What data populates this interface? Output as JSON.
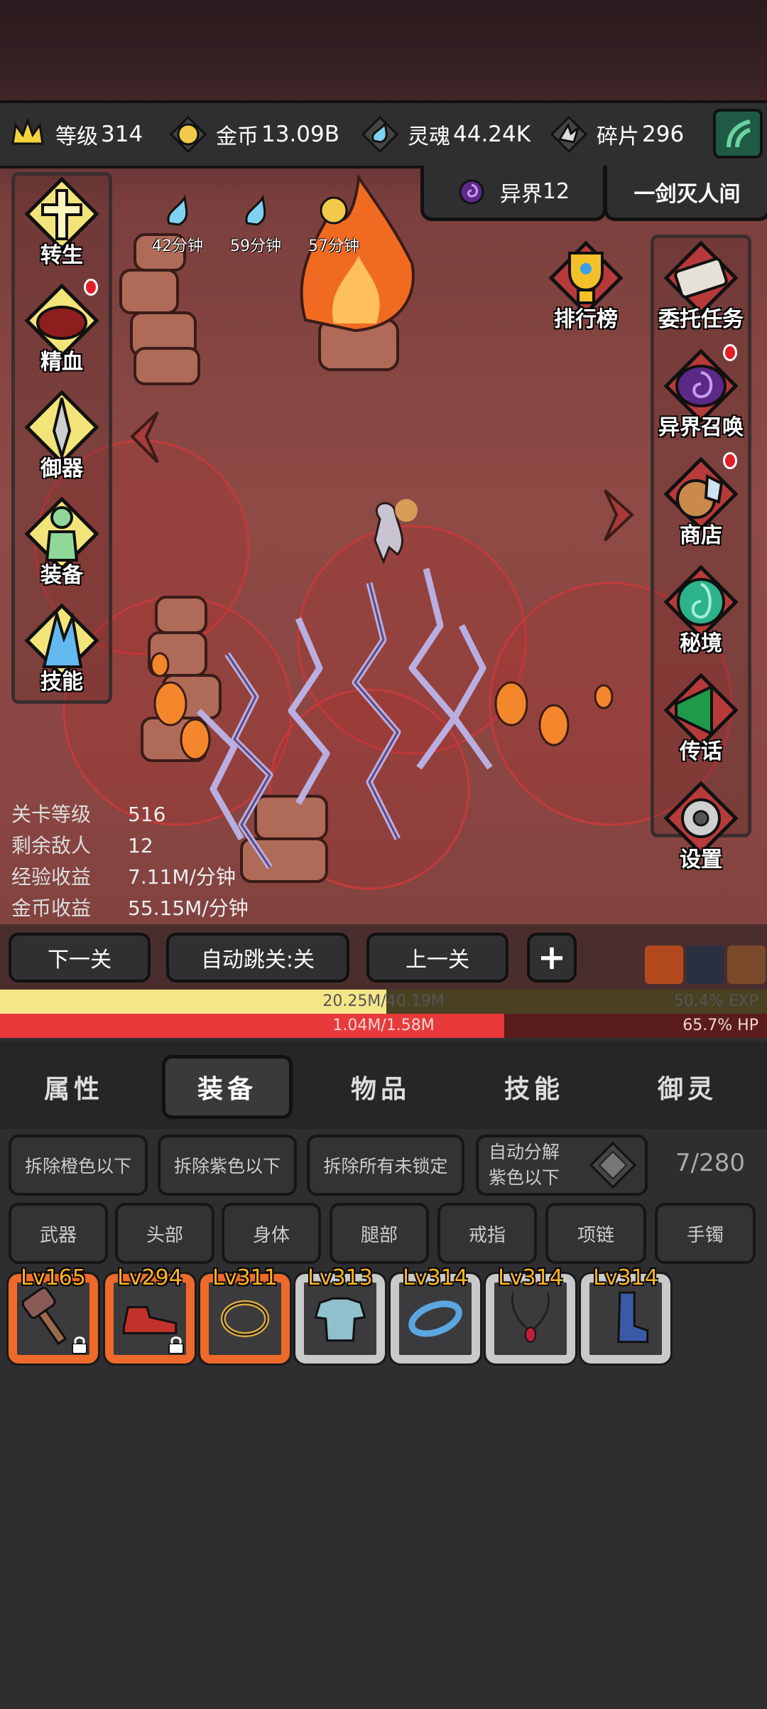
{
  "resources": [
    {
      "label": "等级",
      "value": "314",
      "icon": "crown-icon"
    },
    {
      "label": "金币",
      "value": "13.09B",
      "icon": "gold-coin-icon"
    },
    {
      "label": "灵魂",
      "value": "44.24K",
      "icon": "soul-icon"
    },
    {
      "label": "碎片",
      "value": "296",
      "icon": "shard-icon"
    }
  ],
  "top_tabs": {
    "otherworld": {
      "label": "异界",
      "value": "12"
    },
    "title": "一剑灭人间"
  },
  "timers": [
    "42分钟",
    "59分钟",
    "57分钟"
  ],
  "left_menu": [
    {
      "label": "转生",
      "icon": "rebirth-cross-icon",
      "badge": false
    },
    {
      "label": "精血",
      "icon": "blood-meat-icon",
      "badge": true
    },
    {
      "label": "御器",
      "icon": "sword-icon",
      "badge": false
    },
    {
      "label": "装备",
      "icon": "armor-figure-icon",
      "badge": false
    },
    {
      "label": "技能",
      "icon": "ice-crystal-icon",
      "badge": false
    }
  ],
  "right_menu": [
    {
      "label": "排行榜",
      "icon": "trophy-icon",
      "badge": false
    },
    {
      "label": "委托任务",
      "icon": "scroll-icon",
      "badge": false
    },
    {
      "label": "异界召唤",
      "icon": "portal-icon",
      "badge": true
    },
    {
      "label": "商店",
      "icon": "shop-pot-icon",
      "badge": true
    },
    {
      "label": "秘境",
      "icon": "secret-realm-icon",
      "badge": false
    },
    {
      "label": "传话",
      "icon": "megaphone-icon",
      "badge": false
    },
    {
      "label": "设置",
      "icon": "gear-icon",
      "badge": false
    }
  ],
  "stats": [
    {
      "key": "关卡等级",
      "value": "516"
    },
    {
      "key": "剩余敌人",
      "value": "12"
    },
    {
      "key": "经验收益",
      "value": "7.11M/分钟"
    },
    {
      "key": "金币收益",
      "value": "55.15M/分钟"
    }
  ],
  "actions": {
    "next": "下一关",
    "auto_skip": "自动跳关:关",
    "prev": "上一关",
    "plus": "+"
  },
  "exp_bar": {
    "text": "20.25M/40.19M",
    "percent": "50.4% EXP",
    "fraction": 0.504
  },
  "hp_bar": {
    "text": "1.04M/1.58M",
    "percent": "65.7%  HP",
    "fraction": 0.657
  },
  "tabs": [
    "属性",
    "装备",
    "物品",
    "技能",
    "御灵"
  ],
  "active_tab": "装备",
  "filters": {
    "remove_orange": "拆除橙色以下",
    "remove_purple": "拆除紫色以下",
    "remove_unlocked": "拆除所有未锁定",
    "auto_decompose_1": "自动分解",
    "auto_decompose_2": "紫色以下",
    "capacity": "7/280"
  },
  "slot_tabs": [
    "武器",
    "头部",
    "身体",
    "腿部",
    "戒指",
    "项链",
    "手镯"
  ],
  "items": [
    {
      "level": "Lv165",
      "rarity": "orange",
      "icon": "hammer-icon",
      "locked": true
    },
    {
      "level": "Lv294",
      "rarity": "orange",
      "icon": "boot-icon",
      "locked": true
    },
    {
      "level": "Lv311",
      "rarity": "orange",
      "icon": "ring-icon",
      "locked": false
    },
    {
      "level": "Lv313",
      "rarity": "white",
      "icon": "chest-armor-icon",
      "locked": false
    },
    {
      "level": "Lv314",
      "rarity": "white",
      "icon": "bracelet-icon",
      "locked": false
    },
    {
      "level": "Lv314",
      "rarity": "white",
      "icon": "necklace-icon",
      "locked": false
    },
    {
      "level": "Lv314",
      "rarity": "white",
      "icon": "leg-boot-icon",
      "locked": false
    }
  ],
  "colors": {
    "orange_rarity": "#ee6a2a",
    "exp_bar": "#f5e68a",
    "hp_bar": "#e83a3a",
    "level_text": "#ffb320"
  }
}
